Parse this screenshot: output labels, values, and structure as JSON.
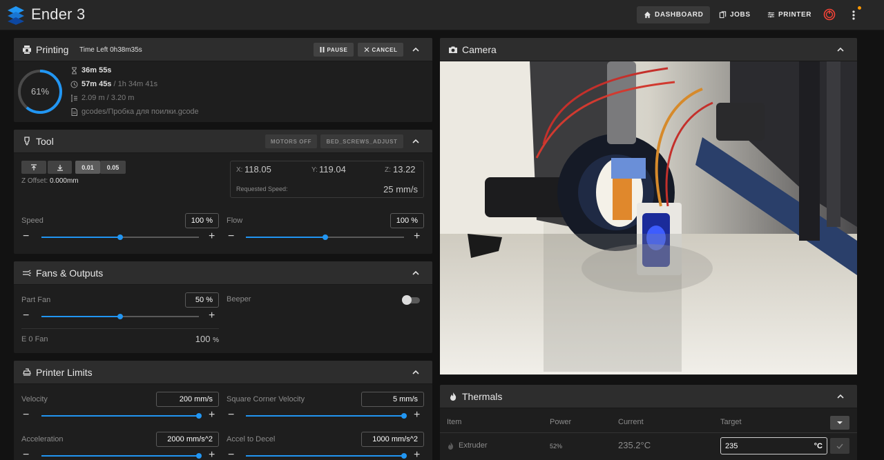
{
  "app": {
    "title": "Ender 3"
  },
  "nav": {
    "dashboard": "DASHBOARD",
    "jobs": "JOBS",
    "printer": "PRINTER"
  },
  "printing": {
    "title": "Printing",
    "time_left": "Time Left 0h38m35s",
    "pause": "PAUSE",
    "cancel": "CANCEL",
    "progress_label": "61%",
    "progress": 0.61,
    "elapsed": "36m 55s",
    "total_time": "57m 45s",
    "total_time_sep": " / ",
    "estimate": "1h 34m 41s",
    "filament": "2.09 m / 3.20 m",
    "file": "gcodes/Пробка для поилки.gcode"
  },
  "tool": {
    "title": "Tool",
    "motors_off": "MOTORS OFF",
    "bed_screws": "BED_SCREWS_ADJUST",
    "step_1": "0.01",
    "step_2": "0.05",
    "z_offset_label": "Z Offset:",
    "z_offset_value": "0.000mm",
    "x_label": "X:",
    "x_value": "118.05",
    "y_label": "Y:",
    "y_value": "119.04",
    "z_label": "Z:",
    "z_value": "13.22",
    "requested_speed_label": "Requested Speed:",
    "requested_speed_value": "25 mm/s",
    "speed_label": "Speed",
    "speed_value": "100 %",
    "speed_level": 0.5,
    "flow_label": "Flow",
    "flow_value": "100 %",
    "flow_level": 0.5
  },
  "fans": {
    "title": "Fans & Outputs",
    "part_fan_label": "Part Fan",
    "part_fan_value": "50 %",
    "part_fan_level": 0.5,
    "beeper_label": "Beeper",
    "e0_fan_label": "E 0 Fan",
    "e0_fan_value": "100",
    "e0_fan_unit": "%"
  },
  "limits": {
    "title": "Printer Limits",
    "velocity_label": "Velocity",
    "velocity_value": "200 mm/s",
    "velocity_level": 1.0,
    "scv_label": "Square Corner Velocity",
    "scv_value": "5 mm/s",
    "scv_level": 1.0,
    "accel_label": "Acceleration",
    "accel_value": "2000 mm/s^2",
    "accel_level": 1.0,
    "decel_label": "Accel to Decel",
    "decel_value": "1000 mm/s^2",
    "decel_level": 1.0
  },
  "camera": {
    "title": "Camera"
  },
  "thermals": {
    "title": "Thermals",
    "col_item": "Item",
    "col_power": "Power",
    "col_current": "Current",
    "col_target": "Target",
    "extruder_label": "Extruder",
    "extruder_power": "52%",
    "extruder_current": "235.2°C",
    "extruder_target": "235",
    "target_unit": "°C"
  },
  "colors": {
    "accent": "#2196f3",
    "estop": "#f44336",
    "notification": "#ff9800"
  }
}
